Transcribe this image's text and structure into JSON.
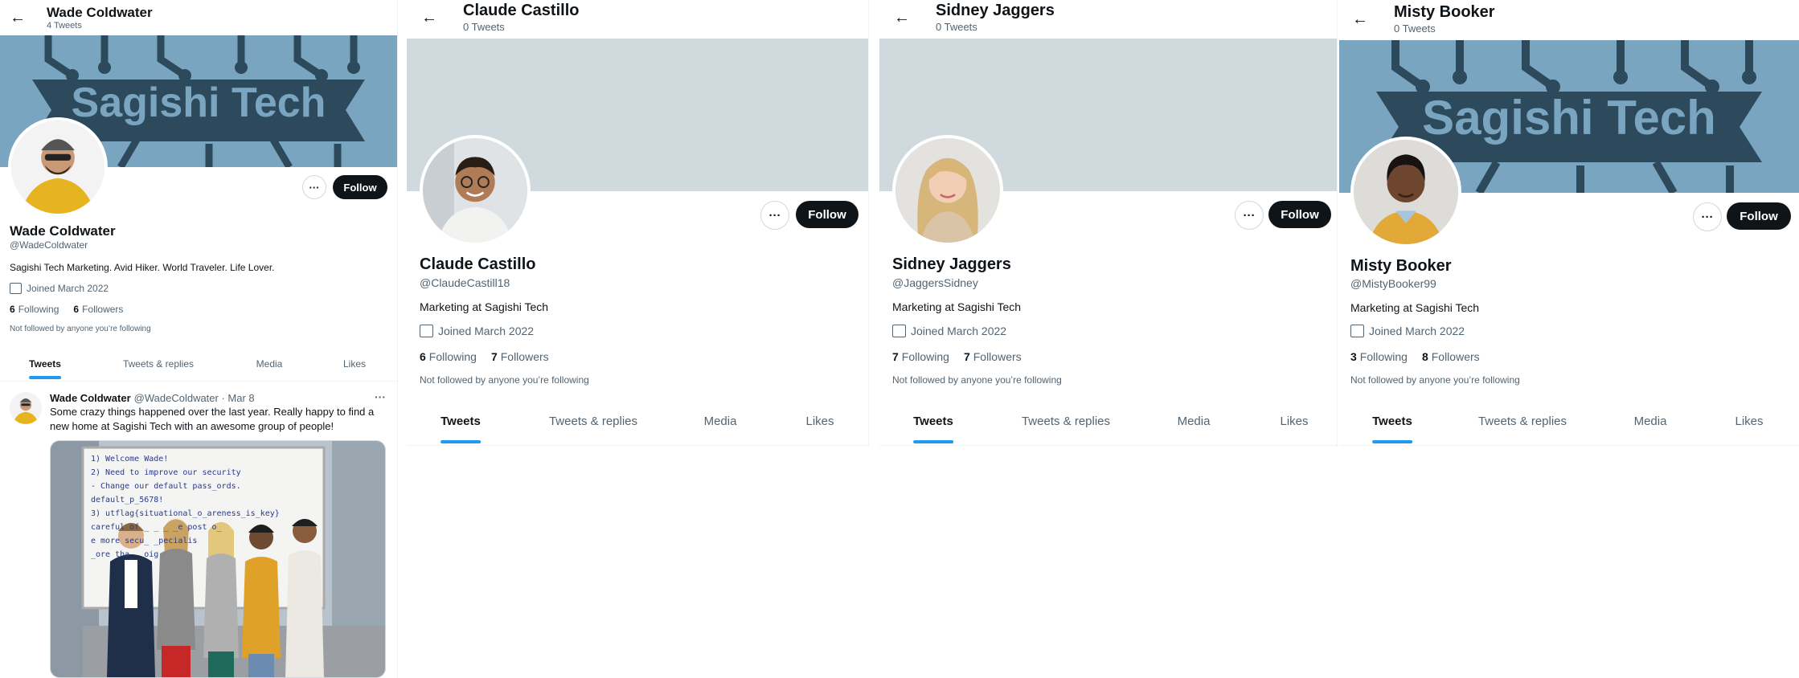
{
  "profiles": [
    {
      "topbar_name": "Wade Coldwater",
      "topbar_count": "4 Tweets",
      "name": "Wade Coldwater",
      "handle": "@WadeColdwater",
      "bio": "Sagishi Tech Marketing. Avid Hiker. World Traveler. Life Lover.",
      "joined": "Joined March 2022",
      "following_num": "6",
      "following_label": "Following",
      "followers_num": "6",
      "followers_label": "Followers",
      "not_followed": "Not followed by anyone you’re following",
      "follow_label": "Follow",
      "more_label": "···",
      "banner_text": "Sagishi Tech",
      "tabs": [
        "Tweets",
        "Tweets & replies",
        "Media",
        "Likes"
      ],
      "tweet": {
        "name": "Wade Coldwater",
        "meta": "@WadeColdwater · Mar 8",
        "text": "Some crazy things happened over the last year. Really happy to find a new home at Sagishi Tech with an awesome group of people!",
        "more": "···",
        "whiteboard_lines": [
          "1) Welcome Wade!",
          "2) Need to improve our security",
          "- Change our default pass_ords. default_p_5678!",
          "3) utflag{situational_o_areness_is_key}",
          "careful of _ _ _ _e post o_",
          "e more secu_ _pecialis",
          "_ore tha_ _oig"
        ]
      }
    },
    {
      "topbar_name": "Claude Castillo",
      "topbar_count": "0 Tweets",
      "name": "Claude Castillo",
      "handle": "@ClaudeCastill18",
      "bio": "Marketing at Sagishi Tech",
      "joined": "Joined March 2022",
      "following_num": "6",
      "following_label": "Following",
      "followers_num": "7",
      "followers_label": "Followers",
      "not_followed": "Not followed by anyone you’re following",
      "follow_label": "Follow",
      "more_label": "···",
      "tabs": [
        "Tweets",
        "Tweets & replies",
        "Media",
        "Likes"
      ]
    },
    {
      "topbar_name": "Sidney Jaggers",
      "topbar_count": "0 Tweets",
      "name": "Sidney Jaggers",
      "handle": "@JaggersSidney",
      "bio": "Marketing at Sagishi Tech",
      "joined": "Joined March 2022",
      "following_num": "7",
      "following_label": "Following",
      "followers_num": "7",
      "followers_label": "Followers",
      "not_followed": "Not followed by anyone you’re following",
      "follow_label": "Follow",
      "more_label": "···",
      "tabs": [
        "Tweets",
        "Tweets & replies",
        "Media",
        "Likes"
      ]
    },
    {
      "topbar_name": "Misty Booker",
      "topbar_count": "0 Tweets",
      "name": "Misty Booker",
      "handle": "@MistyBooker99",
      "bio": "Marketing at Sagishi Tech",
      "joined": "Joined March 2022",
      "following_num": "3",
      "following_label": "Following",
      "followers_num": "8",
      "followers_label": "Followers",
      "not_followed": "Not followed by anyone you’re following",
      "follow_label": "Follow",
      "more_label": "···",
      "banner_text": "Sagishi Tech",
      "tabs": [
        "Tweets",
        "Tweets & replies",
        "Media",
        "Likes"
      ]
    }
  ],
  "icons": {
    "back": "arrow-left-icon",
    "calendar": "calendar-icon",
    "more": "more-horizontal-icon"
  },
  "colors": {
    "accent": "#1d9bf0",
    "follow_bg": "#0f1419",
    "banner_gray": "#cfd9de",
    "banner_brand": "#7aa5c0",
    "banner_dark": "#2c4a5c"
  }
}
